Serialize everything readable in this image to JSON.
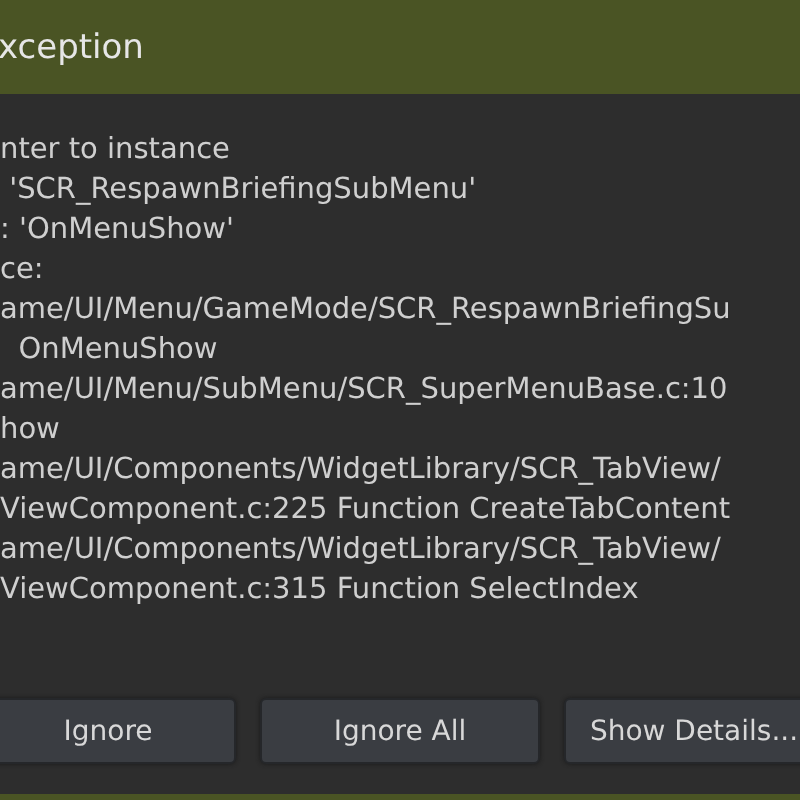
{
  "window": {
    "title": "xception"
  },
  "message_lines": [
    "nter to instance",
    " 'SCR_RespawnBriefingSubMenu'",
    ": 'OnMenuShow'",
    "ce:",
    "ame/UI/Menu/GameMode/SCR_RespawnBriefingSu",
    "  OnMenuShow",
    "ame/UI/Menu/SubMenu/SCR_SuperMenuBase.c:10",
    "how",
    "ame/UI/Components/WidgetLibrary/SCR_TabView/",
    "ViewComponent.c:225 Function CreateTabContent",
    "ame/UI/Components/WidgetLibrary/SCR_TabView/",
    "ViewComponent.c:315 Function SelectIndex"
  ],
  "buttons": [
    "Ignore",
    "Ignore All",
    "Show Details..."
  ]
}
